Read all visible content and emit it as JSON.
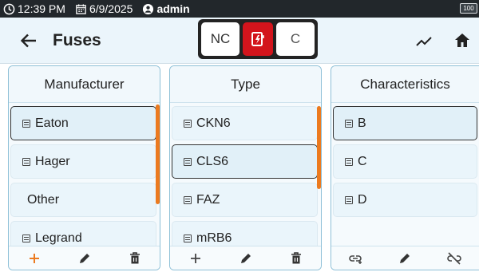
{
  "status": {
    "time": "12:39 PM",
    "date": "6/9/2025",
    "user": "admin",
    "battery": "100",
    "icons": {
      "clock": "clock-icon",
      "calendar": "calendar-icon",
      "user": "user-icon",
      "battery": "battery-icon"
    }
  },
  "header": {
    "title": "Fuses",
    "back_icon": "arrow-left-icon",
    "toggle": {
      "nc": "NC",
      "mid_icon": "fuse-lightning-icon",
      "c": "C"
    },
    "trend_icon": "trend-icon",
    "home_icon": "home-icon"
  },
  "columns": {
    "manufacturer": {
      "title": "Manufacturer",
      "items": [
        {
          "label": "Eaton",
          "icon": true,
          "selected": true
        },
        {
          "label": "Hager",
          "icon": true,
          "selected": false
        },
        {
          "label": "Other",
          "icon": false,
          "selected": false
        },
        {
          "label": "Legrand",
          "icon": true,
          "selected": false
        }
      ],
      "footer": [
        "plus-icon",
        "pencil-icon",
        "trash-icon"
      ]
    },
    "type": {
      "title": "Type",
      "items": [
        {
          "label": "CKN6",
          "icon": true,
          "selected": false
        },
        {
          "label": "CLS6",
          "icon": true,
          "selected": true
        },
        {
          "label": "FAZ",
          "icon": true,
          "selected": false
        },
        {
          "label": "mRB6",
          "icon": true,
          "selected": false
        }
      ],
      "footer": [
        "plus-icon",
        "pencil-icon",
        "trash-icon"
      ]
    },
    "characteristics": {
      "title": "Characteristics",
      "items": [
        {
          "label": "B",
          "icon": true,
          "selected": true
        },
        {
          "label": "C",
          "icon": true,
          "selected": false
        },
        {
          "label": "D",
          "icon": true,
          "selected": false
        }
      ],
      "footer": [
        "link-add-icon",
        "pencil-icon",
        "unlink-icon"
      ]
    }
  },
  "colors": {
    "accent": "#ec7a1f",
    "header_bg": "#ebf5fb",
    "active_red": "#d3141c",
    "border": "#8ec0d7"
  }
}
